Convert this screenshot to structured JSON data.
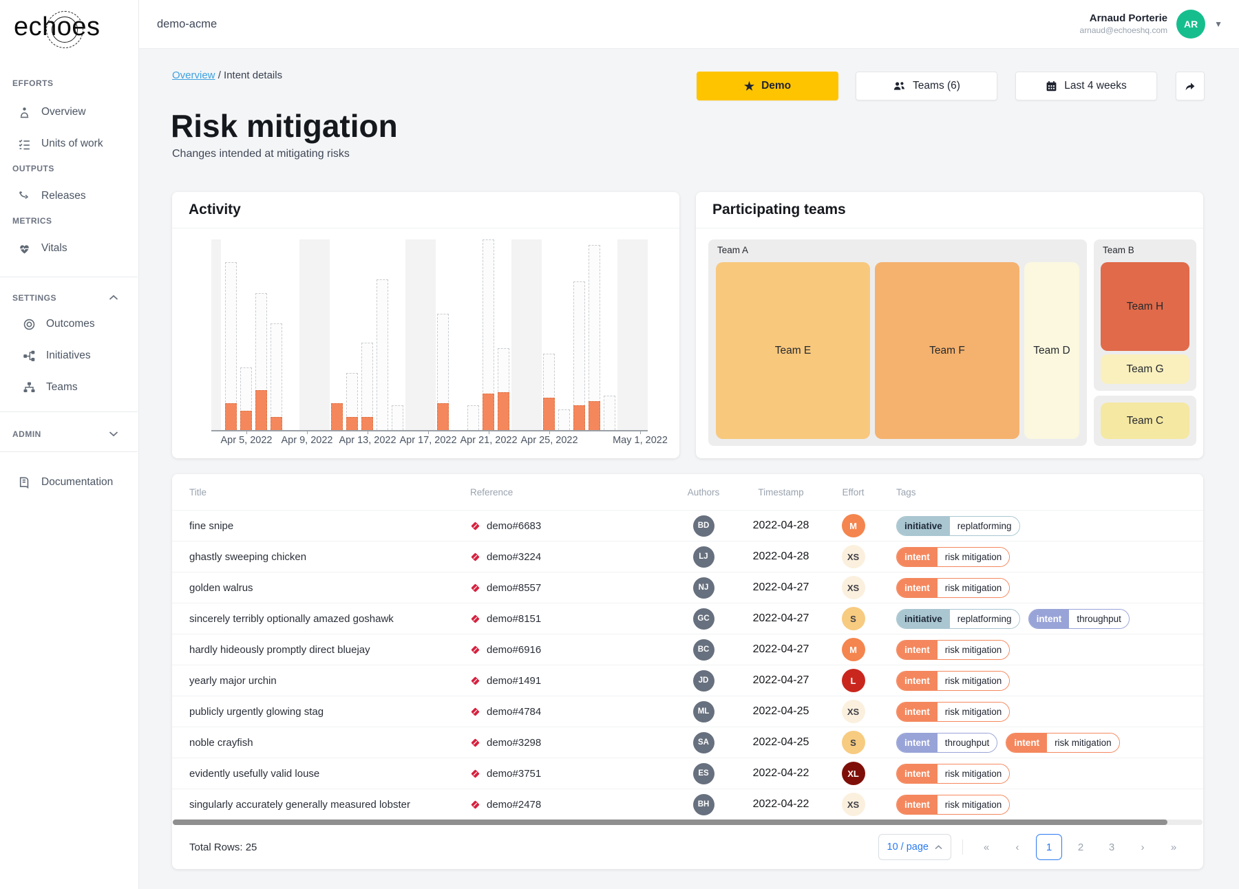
{
  "sidebar": {
    "logo_pre": "ech",
    "logo_o": "o",
    "logo_post": "es",
    "sections": [
      {
        "label": "EFFORTS",
        "items": [
          {
            "label": "Overview"
          },
          {
            "label": "Units of work"
          }
        ]
      },
      {
        "label": "OUTPUTS",
        "items": [
          {
            "label": "Releases"
          }
        ]
      },
      {
        "label": "METRICS",
        "items": [
          {
            "label": "Vitals"
          }
        ]
      },
      {
        "label": "SETTINGS",
        "items": [
          {
            "label": "Outcomes"
          },
          {
            "label": "Initiatives"
          },
          {
            "label": "Teams"
          }
        ]
      },
      {
        "label": "ADMIN",
        "items": []
      },
      {
        "label": "",
        "items": [
          {
            "label": "Documentation"
          }
        ]
      }
    ]
  },
  "topbar": {
    "workspace": "demo-acme",
    "user": {
      "name": "Arnaud Porterie",
      "email": "arnaud@echoeshq.com",
      "initials": "AR",
      "avatar_color": "#16be8e"
    }
  },
  "breadcrumb": {
    "link": "Overview",
    "separator": "/",
    "current": "Intent details"
  },
  "page": {
    "title": "Risk mitigation",
    "subtitle": "Changes intended at mitigating risks"
  },
  "buttons": {
    "demo": "Demo",
    "demo_color": "#ffc400",
    "teams": "Teams (6)",
    "period": "Last 4 weeks"
  },
  "activity_card": {
    "title": "Activity"
  },
  "teams_card": {
    "title": "Participating teams"
  },
  "chart_data": {
    "type": "bar",
    "title": "Activity",
    "x_range": [
      "2022-04-04",
      "2022-05-01"
    ],
    "ylim": [
      0,
      100
    ],
    "units": "percent_of_max",
    "bar_fill": "#fcfcfc",
    "bar_border": "#c8ccd0",
    "highlight_color": "#f5875c",
    "band_color": "#f3f3f4",
    "days": [
      {
        "date": "2022-04-04",
        "total": 88,
        "highlighted": 14
      },
      {
        "date": "2022-04-05",
        "total": 33,
        "highlighted": 10
      },
      {
        "date": "2022-04-06",
        "total": 72,
        "highlighted": 21
      },
      {
        "date": "2022-04-07",
        "total": 56,
        "highlighted": 7
      },
      {
        "date": "2022-04-08",
        "total": 0,
        "highlighted": 0
      },
      {
        "date": "2022-04-09",
        "total": 0,
        "highlighted": 0
      },
      {
        "date": "2022-04-10",
        "total": 0,
        "highlighted": 0
      },
      {
        "date": "2022-04-11",
        "total": 14,
        "highlighted": 14
      },
      {
        "date": "2022-04-12",
        "total": 30,
        "highlighted": 7
      },
      {
        "date": "2022-04-13",
        "total": 46,
        "highlighted": 7
      },
      {
        "date": "2022-04-14",
        "total": 79,
        "highlighted": 0
      },
      {
        "date": "2022-04-15",
        "total": 13,
        "highlighted": 0
      },
      {
        "date": "2022-04-16",
        "total": 0,
        "highlighted": 0
      },
      {
        "date": "2022-04-17",
        "total": 0,
        "highlighted": 0
      },
      {
        "date": "2022-04-18",
        "total": 61,
        "highlighted": 14
      },
      {
        "date": "2022-04-19",
        "total": 0,
        "highlighted": 0
      },
      {
        "date": "2022-04-20",
        "total": 13,
        "highlighted": 0
      },
      {
        "date": "2022-04-21",
        "total": 100,
        "highlighted": 19
      },
      {
        "date": "2022-04-22",
        "total": 43,
        "highlighted": 20
      },
      {
        "date": "2022-04-23",
        "total": 0,
        "highlighted": 0
      },
      {
        "date": "2022-04-24",
        "total": 0,
        "highlighted": 0
      },
      {
        "date": "2022-04-25",
        "total": 40,
        "highlighted": 17
      },
      {
        "date": "2022-04-26",
        "total": 11,
        "highlighted": 0
      },
      {
        "date": "2022-04-27",
        "total": 78,
        "highlighted": 13
      },
      {
        "date": "2022-04-28",
        "total": 97,
        "highlighted": 15
      },
      {
        "date": "2022-04-29",
        "total": 18,
        "highlighted": 0
      },
      {
        "date": "2022-04-30",
        "total": 0,
        "highlighted": 0
      },
      {
        "date": "2022-05-01",
        "total": 0,
        "highlighted": 0
      }
    ],
    "weekend_bands": [
      [
        5,
        6
      ],
      [
        12,
        13
      ],
      [
        19,
        20
      ],
      [
        26,
        27
      ]
    ],
    "ticks": [
      {
        "index": 1,
        "label": "Apr 5, 2022"
      },
      {
        "index": 5,
        "label": "Apr 9, 2022"
      },
      {
        "index": 9,
        "label": "Apr 13, 2022"
      },
      {
        "index": 13,
        "label": "Apr 17, 2022"
      },
      {
        "index": 17,
        "label": "Apr 21, 2022"
      },
      {
        "index": 21,
        "label": "Apr 25, 2022"
      },
      {
        "index": 27,
        "label": "May 1, 2022"
      }
    ]
  },
  "treemap": {
    "groups": [
      {
        "label": "Team A",
        "tiles": [
          {
            "label": "Team E",
            "color": "#f8c87d"
          },
          {
            "label": "Team F",
            "color": "#f5b26e"
          },
          {
            "label": "Team D",
            "color": "#fbf8df"
          }
        ]
      },
      {
        "label": "Team B",
        "tiles": [
          {
            "label": "Team H",
            "color": "#e06a4a"
          },
          {
            "label": "Team G",
            "color": "#faf0be"
          }
        ]
      },
      {
        "label": "",
        "tiles": [
          {
            "label": "Team C",
            "color": "#f5e8a2"
          }
        ]
      }
    ]
  },
  "table": {
    "headers": [
      "Title",
      "Reference",
      "Authors",
      "Timestamp",
      "Effort",
      "Tags"
    ],
    "avatar_color": "#67707e",
    "reference_icon_color": "#d6213f",
    "rows": [
      {
        "title": "fine snipe",
        "reference": "demo#6683",
        "author": "BD",
        "timestamp": "2022-04-28",
        "effort": {
          "label": "M",
          "bg": "#f4854e",
          "fg": "#ffffff"
        },
        "tags": [
          {
            "category": "initiative",
            "label": "replatforming",
            "color": "#a9c6d1",
            "category_fg": "#1f2937"
          }
        ]
      },
      {
        "title": "ghastly sweeping chicken",
        "reference": "demo#3224",
        "author": "LJ",
        "timestamp": "2022-04-28",
        "effort": {
          "label": "XS",
          "bg": "#fbf0de",
          "fg": "#3f3f46"
        },
        "tags": [
          {
            "category": "intent",
            "label": "risk mitigation",
            "color": "#f4875d",
            "category_fg": "#ffffff"
          }
        ]
      },
      {
        "title": "golden walrus",
        "reference": "demo#8557",
        "author": "NJ",
        "timestamp": "2022-04-27",
        "effort": {
          "label": "XS",
          "bg": "#fbf0de",
          "fg": "#3f3f46"
        },
        "tags": [
          {
            "category": "intent",
            "label": "risk mitigation",
            "color": "#f4875d",
            "category_fg": "#ffffff"
          }
        ]
      },
      {
        "title": "sincerely terribly optionally amazed goshawk",
        "reference": "demo#8151",
        "author": "GC",
        "timestamp": "2022-04-27",
        "effort": {
          "label": "S",
          "bg": "#f7cb80",
          "fg": "#3f3f46"
        },
        "tags": [
          {
            "category": "initiative",
            "label": "replatforming",
            "color": "#a9c6d1",
            "category_fg": "#1f2937"
          },
          {
            "category": "intent",
            "label": "throughput",
            "color": "#98a3d7",
            "category_fg": "#ffffff"
          }
        ]
      },
      {
        "title": "hardly hideously promptly direct bluejay",
        "reference": "demo#6916",
        "author": "BC",
        "timestamp": "2022-04-27",
        "effort": {
          "label": "M",
          "bg": "#f4854e",
          "fg": "#ffffff"
        },
        "tags": [
          {
            "category": "intent",
            "label": "risk mitigation",
            "color": "#f4875d",
            "category_fg": "#ffffff"
          }
        ]
      },
      {
        "title": "yearly major urchin",
        "reference": "demo#1491",
        "author": "JD",
        "timestamp": "2022-04-27",
        "effort": {
          "label": "L",
          "bg": "#c9271e",
          "fg": "#ffffff"
        },
        "tags": [
          {
            "category": "intent",
            "label": "risk mitigation",
            "color": "#f4875d",
            "category_fg": "#ffffff"
          }
        ]
      },
      {
        "title": "publicly urgently glowing stag",
        "reference": "demo#4784",
        "author": "ML",
        "timestamp": "2022-04-25",
        "effort": {
          "label": "XS",
          "bg": "#fbf0de",
          "fg": "#3f3f46"
        },
        "tags": [
          {
            "category": "intent",
            "label": "risk mitigation",
            "color": "#f4875d",
            "category_fg": "#ffffff"
          }
        ]
      },
      {
        "title": "noble crayfish",
        "reference": "demo#3298",
        "author": "SA",
        "timestamp": "2022-04-25",
        "effort": {
          "label": "S",
          "bg": "#f7cb80",
          "fg": "#3f3f46"
        },
        "tags": [
          {
            "category": "intent",
            "label": "throughput",
            "color": "#98a3d7",
            "category_fg": "#ffffff"
          },
          {
            "category": "intent",
            "label": "risk mitigation",
            "color": "#f4875d",
            "category_fg": "#ffffff"
          }
        ]
      },
      {
        "title": "evidently usefully valid louse",
        "reference": "demo#3751",
        "author": "ES",
        "timestamp": "2022-04-22",
        "effort": {
          "label": "XL",
          "bg": "#7e0f08",
          "fg": "#ffffff"
        },
        "tags": [
          {
            "category": "intent",
            "label": "risk mitigation",
            "color": "#f4875d",
            "category_fg": "#ffffff"
          }
        ]
      },
      {
        "title": "singularly accurately generally measured lobster",
        "reference": "demo#2478",
        "author": "BH",
        "timestamp": "2022-04-22",
        "effort": {
          "label": "XS",
          "bg": "#fbf0de",
          "fg": "#3f3f46"
        },
        "tags": [
          {
            "category": "intent",
            "label": "risk mitigation",
            "color": "#f4875d",
            "category_fg": "#ffffff"
          }
        ]
      }
    ],
    "footer": {
      "total": "Total Rows: 25",
      "page_size": "10 / page",
      "pagination": {
        "jump_first": "«",
        "prev": "‹",
        "pages": [
          "1",
          "2",
          "3"
        ],
        "next": "›",
        "jump_last": "»",
        "active_page": "1"
      }
    }
  }
}
